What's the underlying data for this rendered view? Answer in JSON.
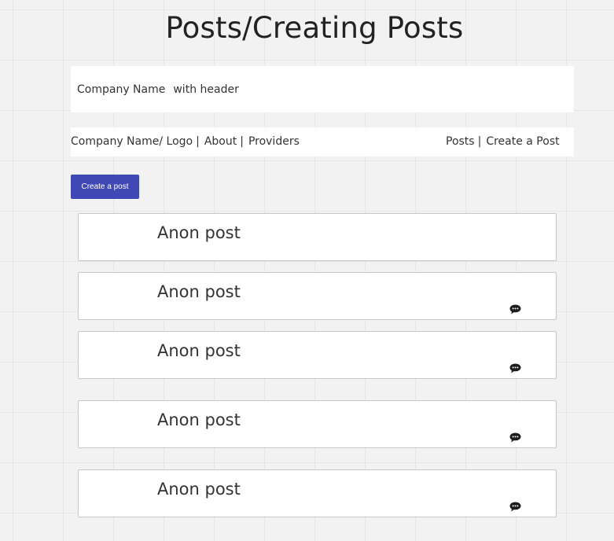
{
  "page": {
    "title": "Posts/Creating Posts"
  },
  "header": {
    "company_name": "Company Name",
    "subtitle": "with header"
  },
  "nav": {
    "left": [
      {
        "label": "Company Name/ Logo"
      },
      {
        "label": "About"
      },
      {
        "label": "Providers"
      }
    ],
    "right": [
      {
        "label": "Posts"
      },
      {
        "label": "Create a Post"
      }
    ],
    "separator": "|"
  },
  "actions": {
    "create_post_label": "Create a post"
  },
  "posts": [
    {
      "title": "Anon post",
      "icon": null
    },
    {
      "title": "Anon post",
      "icon": "comment-icon"
    },
    {
      "title": "Anon post",
      "icon": "comment-icon"
    },
    {
      "title": "Anon post",
      "icon": "comment-icon"
    },
    {
      "title": "Anon post",
      "icon": "comment-icon"
    }
  ],
  "colors": {
    "accent": "#3f48b5",
    "background": "#f2f2f2"
  }
}
